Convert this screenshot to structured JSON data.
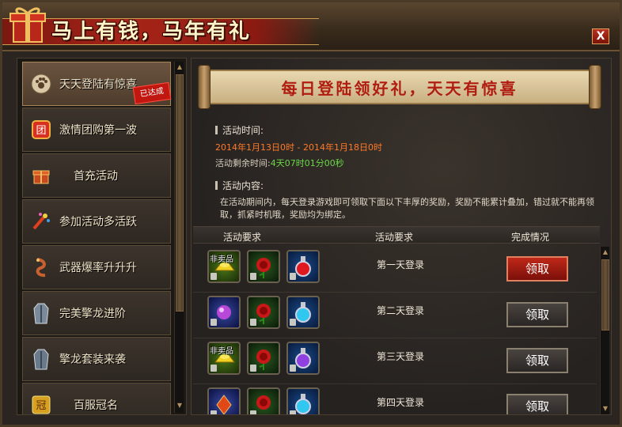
{
  "window": {
    "title": "马上有钱，马年有礼",
    "close_label": "X"
  },
  "sidebar": {
    "items": [
      {
        "label": "天天登陆有惊喜",
        "icon": "paw-icon",
        "active": true,
        "stamp": "已达成"
      },
      {
        "label": "激情团购第一波",
        "icon": "group-buy-icon",
        "active": false
      },
      {
        "label": "首充活动",
        "icon": "gift-box-icon",
        "active": false
      },
      {
        "label": "参加活动多活跃",
        "icon": "firework-icon",
        "active": false
      },
      {
        "label": "武器爆率升升升",
        "icon": "dragon-icon",
        "active": false
      },
      {
        "label": "完美擎龙进阶",
        "icon": "robe-icon",
        "active": false
      },
      {
        "label": "擎龙套装来袭",
        "icon": "robe-icon",
        "active": false
      },
      {
        "label": "百服冠名",
        "icon": "crown-icon",
        "active": false
      }
    ]
  },
  "main": {
    "banner_title": "每日登陆领好礼，天天有惊喜",
    "time_heading": "活动时间:",
    "time_range": "2014年1月13日0时 - 2014年1月18日0时",
    "remaining_prefix": "活动剩余时间:",
    "remaining_value": "4天07时01分00秒",
    "content_heading": "活动内容:",
    "content_text": "在活动期间内，每天登录游戏即可领取下面以下丰厚的奖励，奖励不能累计叠加，错过就不能再领取，抓紧时机哦，奖励均为绑定。",
    "table_headers": [
      "活动要求",
      "活动要求",
      "完成情况"
    ],
    "rows": [
      {
        "day": "第一天登录",
        "button": "领取",
        "hot": true,
        "items": [
          "gold-ingot-icon",
          "rose-icon",
          "red-potion-icon"
        ],
        "tag": "非卖品"
      },
      {
        "day": "第二天登录",
        "button": "领取",
        "hot": false,
        "items": [
          "purple-orb-icon",
          "rose-icon",
          "blue-potion-icon"
        ],
        "tag": ""
      },
      {
        "day": "第三天登录",
        "button": "领取",
        "hot": false,
        "items": [
          "gold-ingot-icon",
          "rose-icon",
          "purple-potion-icon"
        ],
        "tag": "非卖品"
      },
      {
        "day": "第四天登录",
        "button": "领取",
        "hot": false,
        "items": [
          "red-crystal-icon",
          "rose-icon",
          "blue-potion-icon"
        ],
        "tag": ""
      }
    ]
  },
  "colors": {
    "accent_red": "#b01c10",
    "remaining_green": "#6ad848",
    "date_orange": "#ff7a28"
  }
}
